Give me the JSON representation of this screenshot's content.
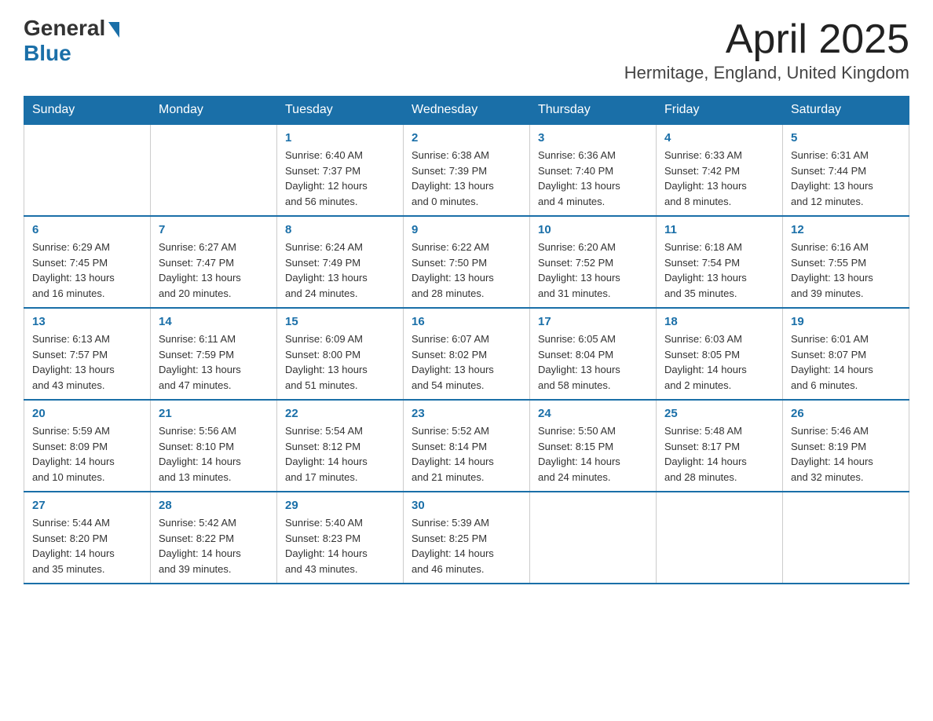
{
  "header": {
    "logo_general": "General",
    "logo_blue": "Blue",
    "month_title": "April 2025",
    "location": "Hermitage, England, United Kingdom"
  },
  "weekdays": [
    "Sunday",
    "Monday",
    "Tuesday",
    "Wednesday",
    "Thursday",
    "Friday",
    "Saturday"
  ],
  "weeks": [
    [
      {
        "day": "",
        "info": ""
      },
      {
        "day": "",
        "info": ""
      },
      {
        "day": "1",
        "info": "Sunrise: 6:40 AM\nSunset: 7:37 PM\nDaylight: 12 hours\nand 56 minutes."
      },
      {
        "day": "2",
        "info": "Sunrise: 6:38 AM\nSunset: 7:39 PM\nDaylight: 13 hours\nand 0 minutes."
      },
      {
        "day": "3",
        "info": "Sunrise: 6:36 AM\nSunset: 7:40 PM\nDaylight: 13 hours\nand 4 minutes."
      },
      {
        "day": "4",
        "info": "Sunrise: 6:33 AM\nSunset: 7:42 PM\nDaylight: 13 hours\nand 8 minutes."
      },
      {
        "day": "5",
        "info": "Sunrise: 6:31 AM\nSunset: 7:44 PM\nDaylight: 13 hours\nand 12 minutes."
      }
    ],
    [
      {
        "day": "6",
        "info": "Sunrise: 6:29 AM\nSunset: 7:45 PM\nDaylight: 13 hours\nand 16 minutes."
      },
      {
        "day": "7",
        "info": "Sunrise: 6:27 AM\nSunset: 7:47 PM\nDaylight: 13 hours\nand 20 minutes."
      },
      {
        "day": "8",
        "info": "Sunrise: 6:24 AM\nSunset: 7:49 PM\nDaylight: 13 hours\nand 24 minutes."
      },
      {
        "day": "9",
        "info": "Sunrise: 6:22 AM\nSunset: 7:50 PM\nDaylight: 13 hours\nand 28 minutes."
      },
      {
        "day": "10",
        "info": "Sunrise: 6:20 AM\nSunset: 7:52 PM\nDaylight: 13 hours\nand 31 minutes."
      },
      {
        "day": "11",
        "info": "Sunrise: 6:18 AM\nSunset: 7:54 PM\nDaylight: 13 hours\nand 35 minutes."
      },
      {
        "day": "12",
        "info": "Sunrise: 6:16 AM\nSunset: 7:55 PM\nDaylight: 13 hours\nand 39 minutes."
      }
    ],
    [
      {
        "day": "13",
        "info": "Sunrise: 6:13 AM\nSunset: 7:57 PM\nDaylight: 13 hours\nand 43 minutes."
      },
      {
        "day": "14",
        "info": "Sunrise: 6:11 AM\nSunset: 7:59 PM\nDaylight: 13 hours\nand 47 minutes."
      },
      {
        "day": "15",
        "info": "Sunrise: 6:09 AM\nSunset: 8:00 PM\nDaylight: 13 hours\nand 51 minutes."
      },
      {
        "day": "16",
        "info": "Sunrise: 6:07 AM\nSunset: 8:02 PM\nDaylight: 13 hours\nand 54 minutes."
      },
      {
        "day": "17",
        "info": "Sunrise: 6:05 AM\nSunset: 8:04 PM\nDaylight: 13 hours\nand 58 minutes."
      },
      {
        "day": "18",
        "info": "Sunrise: 6:03 AM\nSunset: 8:05 PM\nDaylight: 14 hours\nand 2 minutes."
      },
      {
        "day": "19",
        "info": "Sunrise: 6:01 AM\nSunset: 8:07 PM\nDaylight: 14 hours\nand 6 minutes."
      }
    ],
    [
      {
        "day": "20",
        "info": "Sunrise: 5:59 AM\nSunset: 8:09 PM\nDaylight: 14 hours\nand 10 minutes."
      },
      {
        "day": "21",
        "info": "Sunrise: 5:56 AM\nSunset: 8:10 PM\nDaylight: 14 hours\nand 13 minutes."
      },
      {
        "day": "22",
        "info": "Sunrise: 5:54 AM\nSunset: 8:12 PM\nDaylight: 14 hours\nand 17 minutes."
      },
      {
        "day": "23",
        "info": "Sunrise: 5:52 AM\nSunset: 8:14 PM\nDaylight: 14 hours\nand 21 minutes."
      },
      {
        "day": "24",
        "info": "Sunrise: 5:50 AM\nSunset: 8:15 PM\nDaylight: 14 hours\nand 24 minutes."
      },
      {
        "day": "25",
        "info": "Sunrise: 5:48 AM\nSunset: 8:17 PM\nDaylight: 14 hours\nand 28 minutes."
      },
      {
        "day": "26",
        "info": "Sunrise: 5:46 AM\nSunset: 8:19 PM\nDaylight: 14 hours\nand 32 minutes."
      }
    ],
    [
      {
        "day": "27",
        "info": "Sunrise: 5:44 AM\nSunset: 8:20 PM\nDaylight: 14 hours\nand 35 minutes."
      },
      {
        "day": "28",
        "info": "Sunrise: 5:42 AM\nSunset: 8:22 PM\nDaylight: 14 hours\nand 39 minutes."
      },
      {
        "day": "29",
        "info": "Sunrise: 5:40 AM\nSunset: 8:23 PM\nDaylight: 14 hours\nand 43 minutes."
      },
      {
        "day": "30",
        "info": "Sunrise: 5:39 AM\nSunset: 8:25 PM\nDaylight: 14 hours\nand 46 minutes."
      },
      {
        "day": "",
        "info": ""
      },
      {
        "day": "",
        "info": ""
      },
      {
        "day": "",
        "info": ""
      }
    ]
  ]
}
